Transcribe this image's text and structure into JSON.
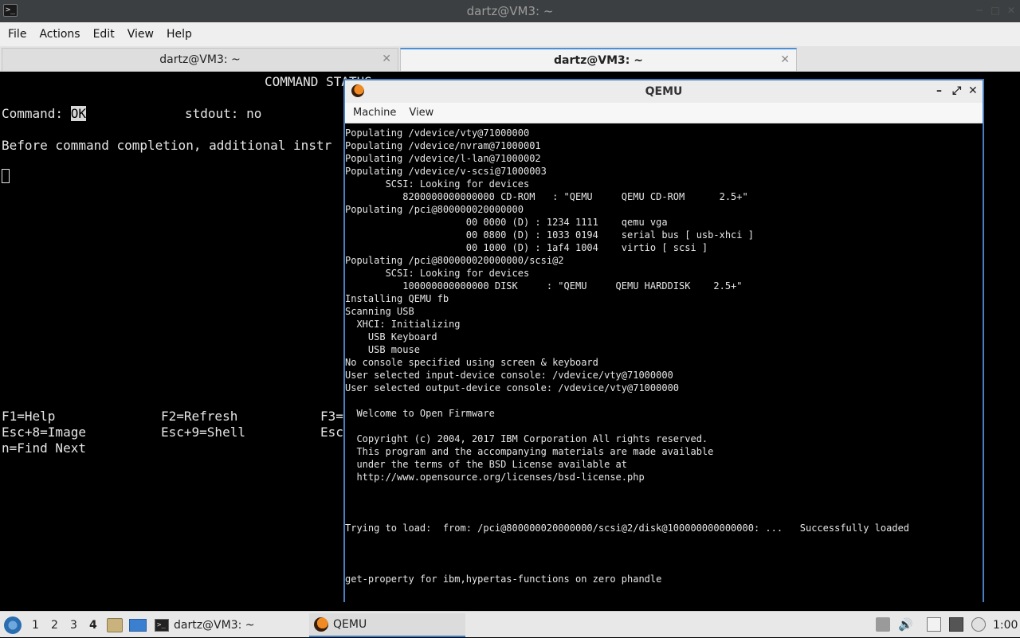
{
  "window": {
    "title": "dartz@VM3: ~"
  },
  "menubar": {
    "items": [
      "File",
      "Actions",
      "Edit",
      "View",
      "Help"
    ]
  },
  "tabs": [
    {
      "label": "dartz@VM3: ~",
      "active": false
    },
    {
      "label": "dartz@VM3: ~",
      "active": true
    }
  ],
  "terminal": {
    "header": "COMMAND STATUS",
    "command_label": "Command: ",
    "command_value": "OK",
    "stdout": "stdout: no",
    "completion": "Before command completion, additional instr",
    "keys_row1": [
      "F1=Help",
      "F2=Refresh",
      "F3="
    ],
    "keys_row2": [
      "Esc+8=Image",
      "Esc+9=Shell",
      "Esc"
    ],
    "keys_row3": "n=Find Next"
  },
  "qemu": {
    "title": "QEMU",
    "menu": [
      "Machine",
      "View"
    ],
    "lines": [
      "Populating /vdevice/vty@71000000",
      "Populating /vdevice/nvram@71000001",
      "Populating /vdevice/l-lan@71000002",
      "Populating /vdevice/v-scsi@71000003",
      "       SCSI: Looking for devices",
      "          8200000000000000 CD-ROM   : \"QEMU     QEMU CD-ROM      2.5+\"",
      "Populating /pci@800000020000000",
      "                     00 0000 (D) : 1234 1111    qemu vga",
      "                     00 0800 (D) : 1033 0194    serial bus [ usb-xhci ]",
      "                     00 1000 (D) : 1af4 1004    virtio [ scsi ]",
      "Populating /pci@800000020000000/scsi@2",
      "       SCSI: Looking for devices",
      "          100000000000000 DISK     : \"QEMU     QEMU HARDDISK    2.5+\"",
      "Installing QEMU fb",
      "Scanning USB",
      "  XHCI: Initializing",
      "    USB Keyboard",
      "    USB mouse",
      "No console specified using screen & keyboard",
      "User selected input-device console: /vdevice/vty@71000000",
      "User selected output-device console: /vdevice/vty@71000000",
      "",
      "  Welcome to Open Firmware",
      "",
      "  Copyright (c) 2004, 2017 IBM Corporation All rights reserved.",
      "  This program and the accompanying materials are made available",
      "  under the terms of the BSD License available at",
      "  http://www.opensource.org/licenses/bsd-license.php",
      "",
      "",
      "",
      "Trying to load:  from: /pci@800000020000000/scsi@2/disk@100000000000000: ...   Successfully loaded",
      "",
      "",
      "",
      "get-property for ibm,hypertas-functions on zero phandle"
    ]
  },
  "taskbar": {
    "desktops": [
      "1",
      "2",
      "3",
      "4"
    ],
    "active_desktop": "4",
    "tasks": [
      {
        "label": "dartz@VM3: ~",
        "icon": "terminal-icon"
      },
      {
        "label": "QEMU",
        "icon": "qemu-icon"
      }
    ],
    "clock": "1:00"
  }
}
